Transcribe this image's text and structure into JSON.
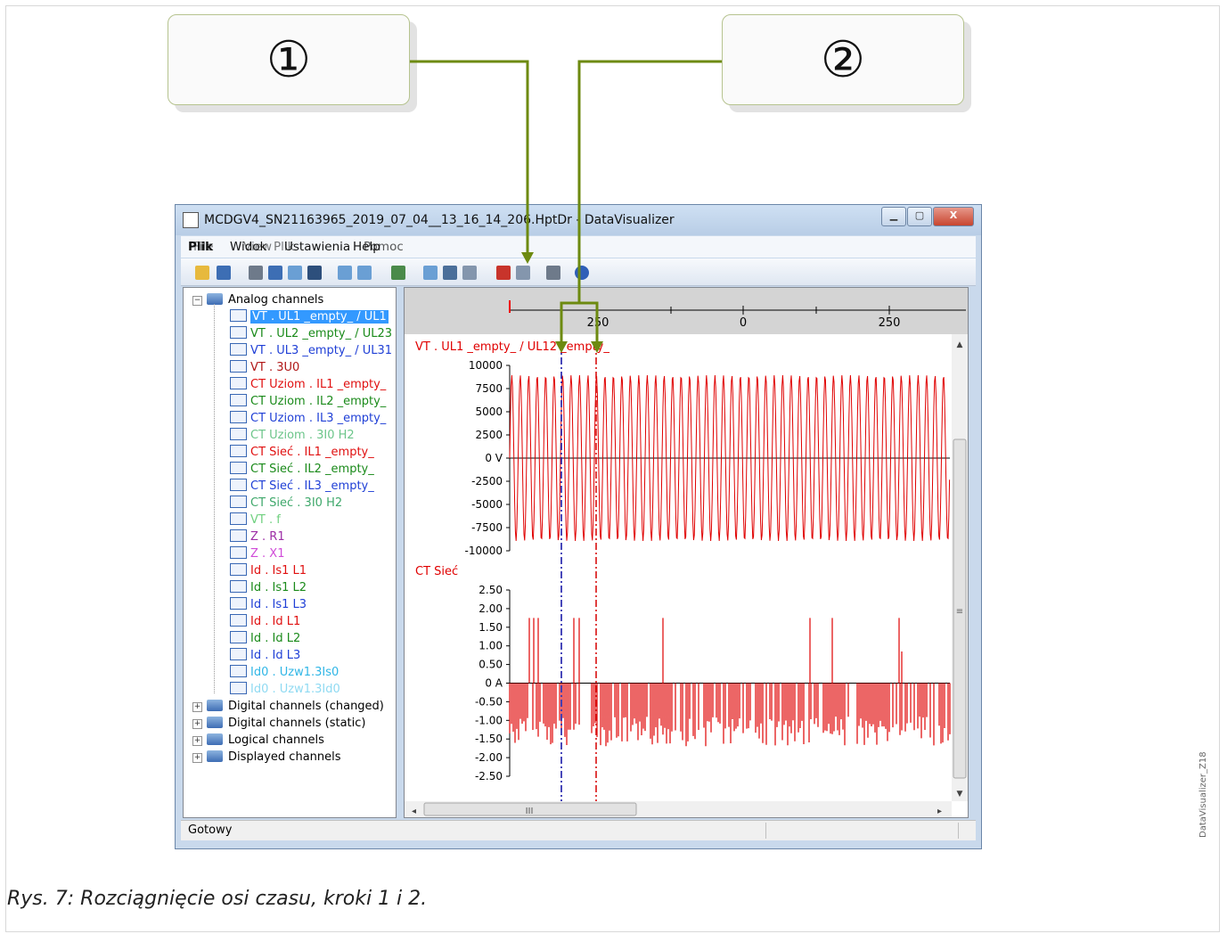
{
  "callouts": {
    "one": "①",
    "two": "②"
  },
  "window": {
    "title": "MCDGV4_SN21163965_2019_07_04__13_16_14_206.HptDr - DataVisualizer",
    "status": "Gotowy"
  },
  "menu": {
    "overlay_a": "Plik",
    "overlay_b": "File",
    "view_a": "Widok",
    "view_b": "View",
    "settings": "Ustawienia",
    "settings_overlay": "Plik",
    "help_a": "Help",
    "help_b": "Pomoc"
  },
  "tree": {
    "analog": "Analog channels",
    "channels": [
      {
        "label": "VT . UL1 _empty_ / UL1",
        "color": "#ffffff",
        "selected": true
      },
      {
        "label": "VT . UL2 _empty_ / UL23",
        "color": "#1a8a1a"
      },
      {
        "label": "VT . UL3 _empty_ / UL31",
        "color": "#1f3fd6"
      },
      {
        "label": "VT . 3U0",
        "color": "#b01717"
      },
      {
        "label": "CT Uziom . IL1 _empty_",
        "color": "#e01010"
      },
      {
        "label": "CT Uziom . IL2 _empty_",
        "color": "#1a8a1a"
      },
      {
        "label": "CT Uziom . IL3 _empty_",
        "color": "#1f3fd6"
      },
      {
        "label": "CT Uziom . 3I0 H2",
        "color": "#6cc58a"
      },
      {
        "label": "CT Sieć . IL1 _empty_",
        "color": "#e01010"
      },
      {
        "label": "CT Sieć . IL2 _empty_",
        "color": "#1a8a1a"
      },
      {
        "label": "CT Sieć . IL3 _empty_",
        "color": "#1f3fd6"
      },
      {
        "label": "CT Sieć . 3I0 H2",
        "color": "#3fa86b"
      },
      {
        "label": "VT . f",
        "color": "#6fd07f"
      },
      {
        "label": "Z . R1",
        "color": "#9d2ea6"
      },
      {
        "label": "Z . X1",
        "color": "#d04bd8"
      },
      {
        "label": "Id . Is1 L1",
        "color": "#e01010"
      },
      {
        "label": "Id . Is1 L2",
        "color": "#1a8a1a"
      },
      {
        "label": "Id . Is1 L3",
        "color": "#1f3fd6"
      },
      {
        "label": "Id . Id L1",
        "color": "#e01010"
      },
      {
        "label": "Id . Id L2",
        "color": "#1a8a1a"
      },
      {
        "label": "Id . Id L3",
        "color": "#1f3fd6"
      },
      {
        "label": "Id0 . Uzw1.3Is0",
        "color": "#2fb6e6"
      },
      {
        "label": "Id0 . Uzw1.3Id0",
        "color": "#8fdaf2"
      }
    ],
    "groups": [
      "Digital channels (changed)",
      "Digital channels (static)",
      "Logical channels",
      "Displayed channels"
    ]
  },
  "plot": {
    "time_ticks": [
      "250",
      "0",
      "250"
    ],
    "panel1_title": "VT . UL1 _empty_ / UL12 _empty_",
    "panel1_ticks": [
      "10000",
      "7500",
      "5000",
      "2500",
      "0 V",
      "-2500",
      "-5000",
      "-7500",
      "-10000"
    ],
    "panel2_title": "CT Sieć",
    "panel2_ticks": [
      "2.50",
      "2.00",
      "1.50",
      "1.00",
      "0.50",
      "0 A",
      "-0.50",
      "-1.00",
      "-1.50",
      "-2.00",
      "-2.50"
    ],
    "scroll_mark": "III",
    "signal_color": "#e00000",
    "cursor1_color": "#1a1aa8",
    "cursor2_color": "#d91010"
  },
  "caption": "Rys. 7: Rozciągnięcie osi czasu, kroki 1 i 2.",
  "side_id": "DataVisualizer_Z18",
  "arrow_color": "#6d8a10"
}
